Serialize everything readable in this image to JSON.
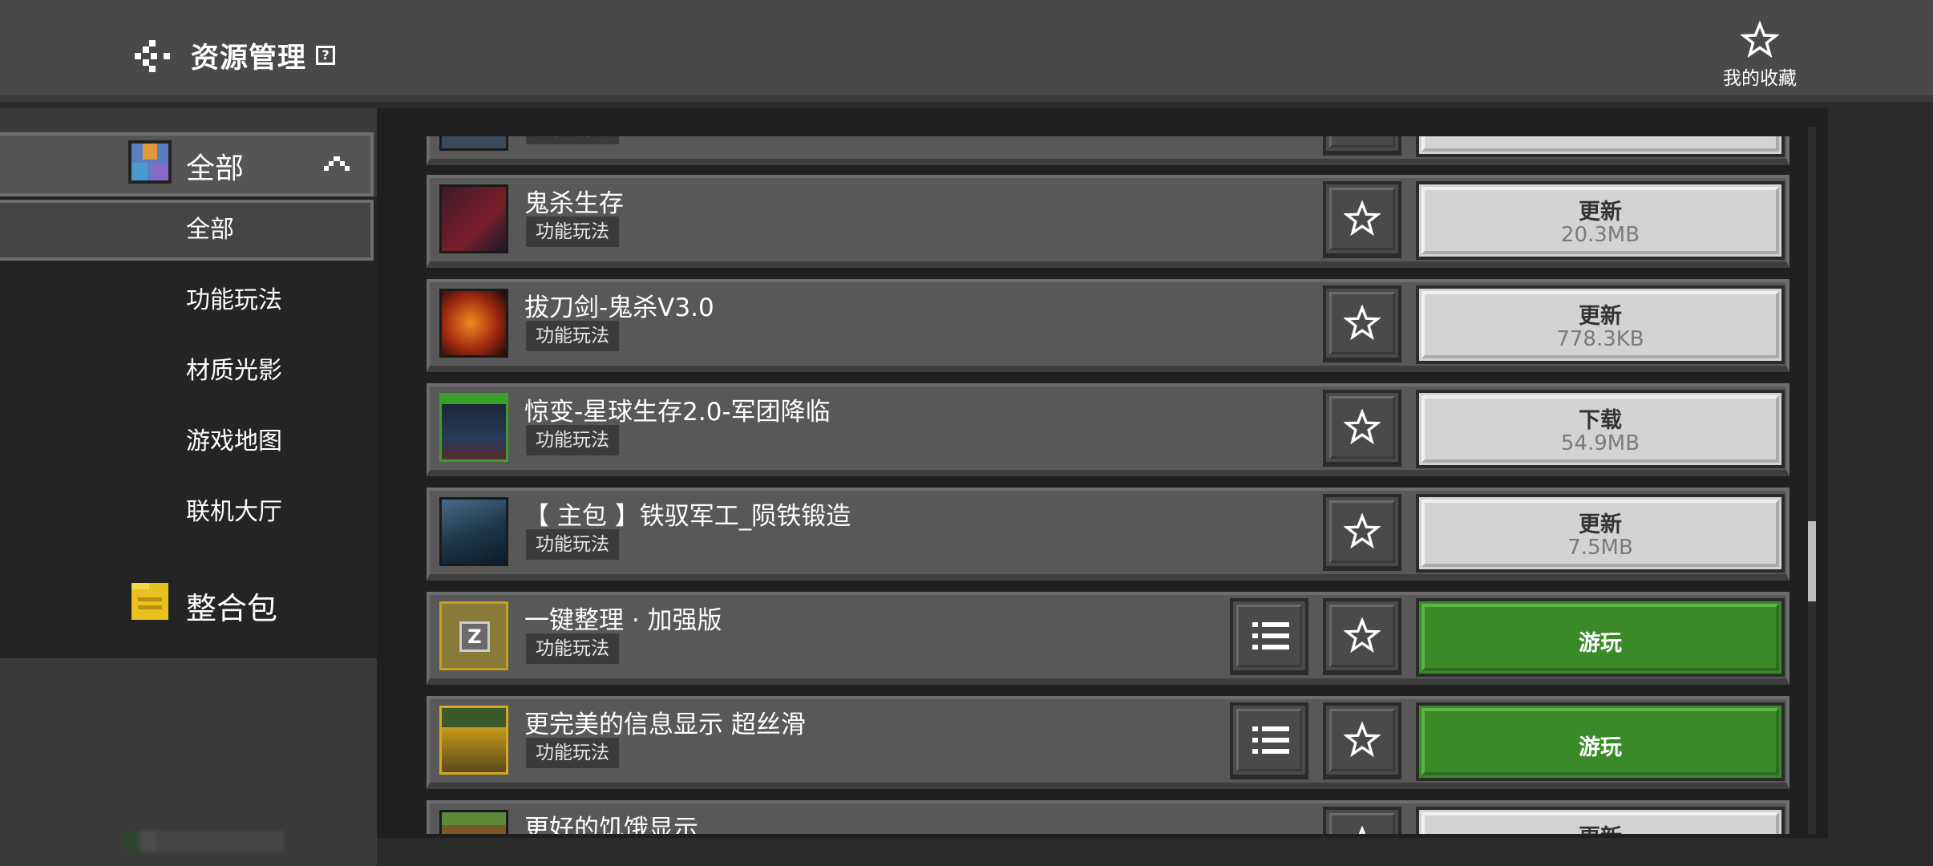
{
  "header": {
    "title": "资源管理",
    "help_icon": "?",
    "favorites_label": "我的收藏"
  },
  "sidebar": {
    "category_all_label": "全部",
    "sub_items": [
      {
        "label": "全部",
        "active": true
      },
      {
        "label": "功能玩法",
        "active": false
      },
      {
        "label": "材质光影",
        "active": false
      },
      {
        "label": "游戏地图",
        "active": false
      },
      {
        "label": "联机大厅",
        "active": false
      }
    ],
    "modpack_label": "整合包"
  },
  "list": {
    "rows": [
      {
        "title": "",
        "tag": "功能玩法",
        "action": "",
        "size": "",
        "has_menu": false,
        "partial": "top"
      },
      {
        "title": "鬼杀生存",
        "tag": "功能玩法",
        "action": "更新",
        "size": "20.3MB",
        "has_menu": false,
        "thumb_color": "#7a1f2a"
      },
      {
        "title": "拔刀剑-鬼杀V3.0",
        "tag": "功能玩法",
        "action": "更新",
        "size": "778.3KB",
        "has_menu": false,
        "thumb_color": "#b84a10"
      },
      {
        "title": "惊变-星球生存2.0-军团降临",
        "tag": "功能玩法",
        "action": "下载",
        "size": "54.9MB",
        "has_menu": false,
        "thumb_color": "#2a4a2a"
      },
      {
        "title": "【 主包 】铁驭军工_陨铁锻造",
        "tag": "功能玩法",
        "action": "更新",
        "size": "7.5MB",
        "has_menu": false,
        "thumb_color": "#1f3a4a"
      },
      {
        "title": "一键整理 · 加强版",
        "tag": "功能玩法",
        "action": "游玩",
        "size": "",
        "has_menu": true,
        "thumb_color": "#8a7a3a"
      },
      {
        "title": "更完美的信息显示 超丝滑",
        "tag": "功能玩法",
        "action": "游玩",
        "size": "",
        "has_menu": true,
        "thumb_color": "#9a7a1a"
      },
      {
        "title": "更好的饥饿显示",
        "tag": "",
        "action": "更新",
        "size": "",
        "has_menu": false,
        "thumb_color": "#4a6a2a",
        "partial": "bottom"
      }
    ]
  },
  "colors": {
    "header_bg": "#494949",
    "play_green": "#3a8a2a",
    "update_gray": "#d3d3d3"
  },
  "icons": {
    "back": "back-arrow-icon",
    "favorite": "star-outline-icon",
    "menu": "list-menu-icon",
    "collapse": "chevron-up-icon"
  }
}
